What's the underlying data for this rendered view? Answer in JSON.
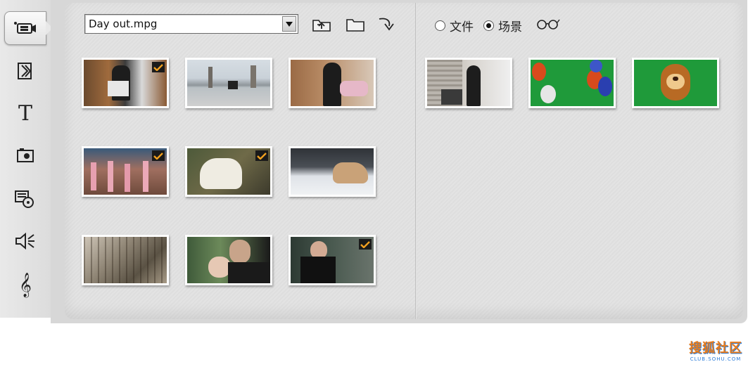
{
  "file_selector": {
    "selected": "Day out.mpg"
  },
  "toolbar": {
    "tools": [
      {
        "name": "video-tool",
        "icon": "camcorder-icon"
      },
      {
        "name": "transition-tool",
        "icon": "transition-icon"
      },
      {
        "name": "title-tool",
        "icon": "title-t-icon"
      },
      {
        "name": "photo-tool",
        "icon": "camera-icon"
      },
      {
        "name": "disc-menu-tool",
        "icon": "disc-menu-icon"
      },
      {
        "name": "sound-effects-tool",
        "icon": "speaker-icon"
      },
      {
        "name": "music-tool",
        "icon": "treble-clef-icon"
      }
    ]
  },
  "title_tool_glyph": "T",
  "music_tool_glyph": "𝄞",
  "view_options": {
    "file_label": "文件",
    "scene_label": "场景",
    "selected": "场景"
  },
  "album_clips": [
    {
      "label": "clip-1",
      "checked": true
    },
    {
      "label": "clip-2",
      "checked": false
    },
    {
      "label": "clip-3",
      "checked": false
    },
    {
      "label": "clip-4",
      "checked": true
    },
    {
      "label": "clip-5",
      "checked": true
    },
    {
      "label": "clip-6",
      "checked": false
    },
    {
      "label": "clip-7",
      "checked": false
    },
    {
      "label": "clip-8",
      "checked": false
    },
    {
      "label": "clip-9",
      "checked": true
    }
  ],
  "scenes": [
    {
      "label": "scene-1"
    },
    {
      "label": "scene-2"
    },
    {
      "label": "scene-3"
    }
  ],
  "watermark": {
    "main": "搜狐社区",
    "sub": "CLUB.SOHU.COM"
  },
  "colors": {
    "accent": "#e77b1b",
    "watermark_blue": "#2a7bd8",
    "chroma_green": "#1f9a3a"
  }
}
